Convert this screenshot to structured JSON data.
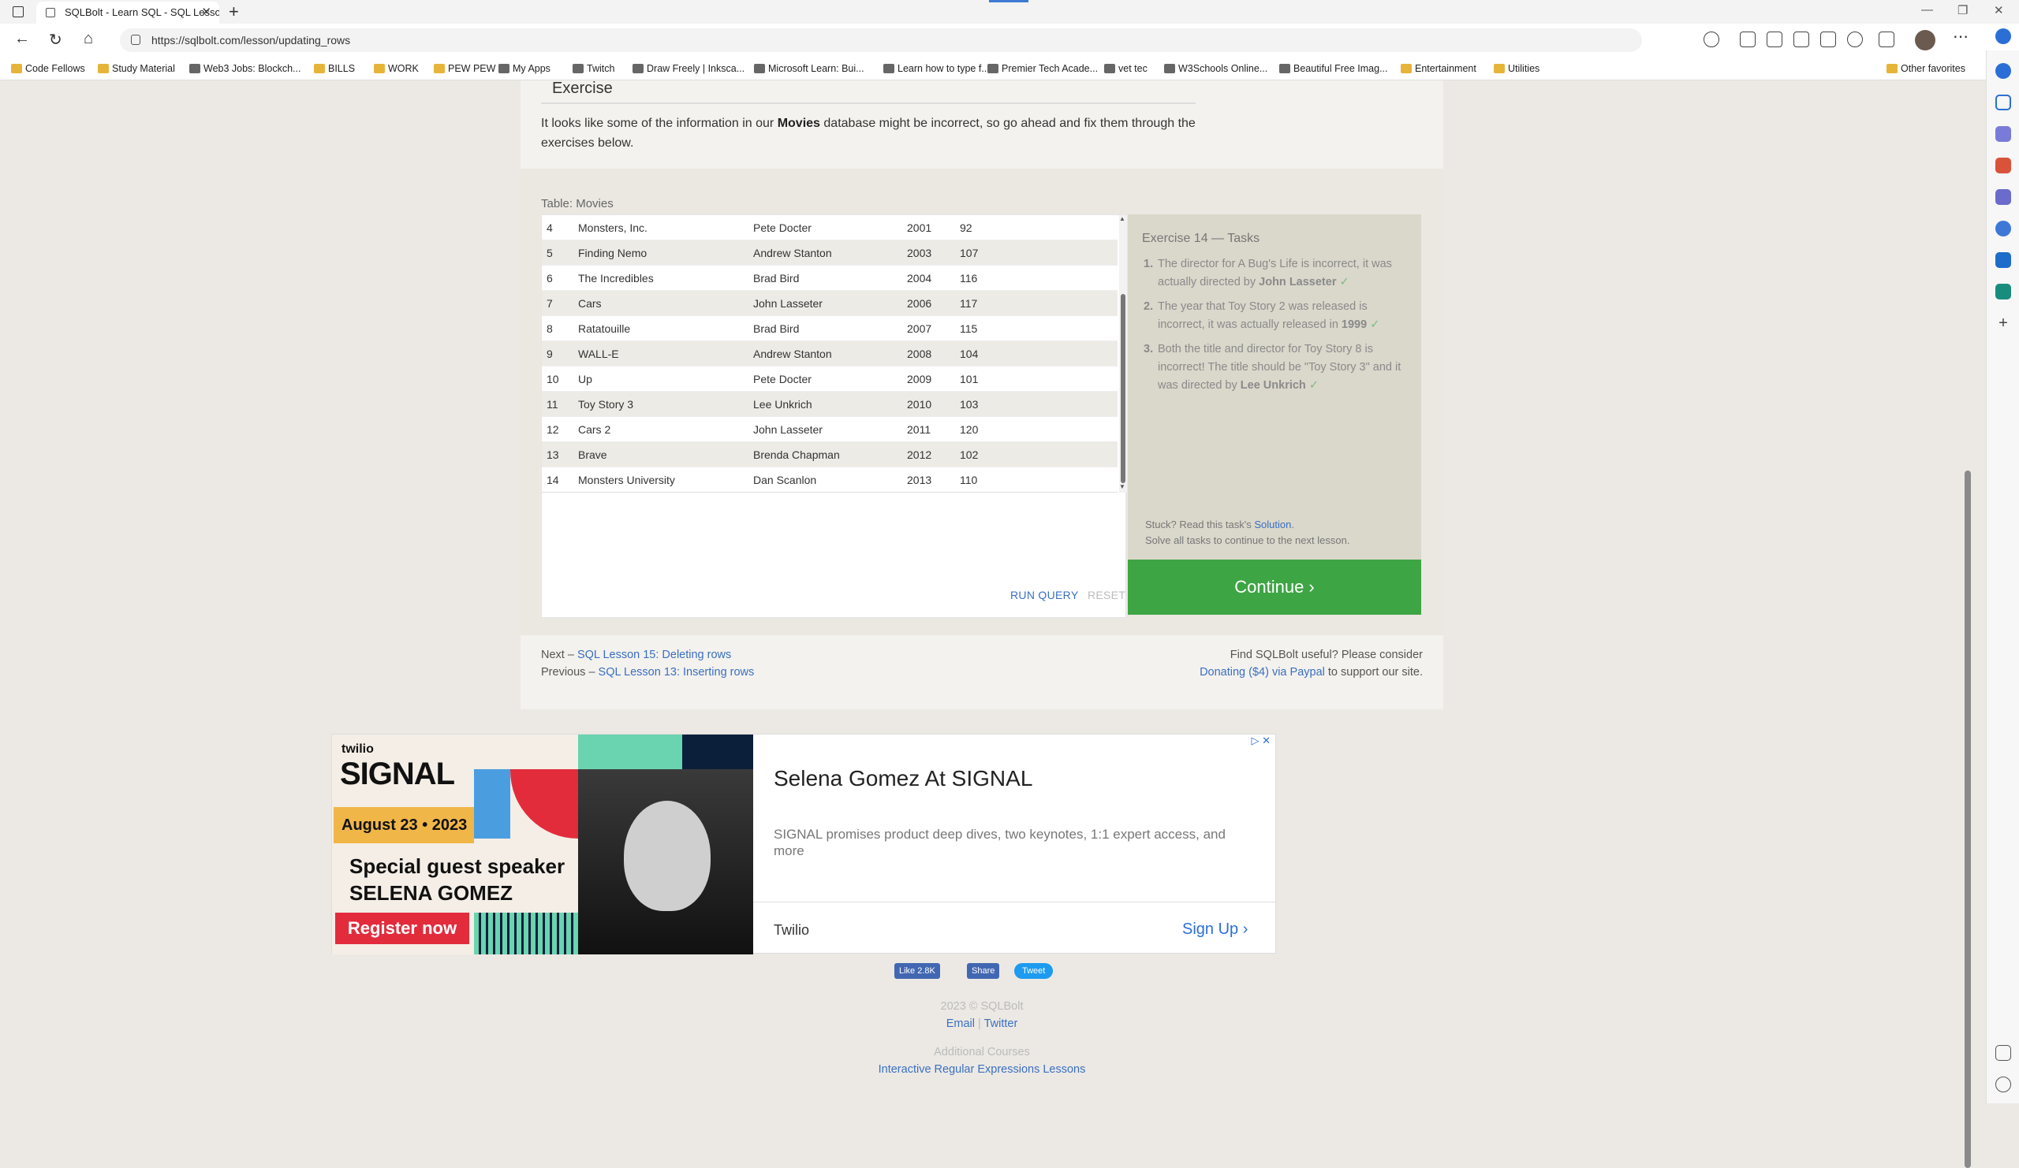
{
  "browser": {
    "tab_title": "SQLBolt - Learn SQL - SQL Lesso",
    "url": "https://sqlbolt.com/lesson/updating_rows",
    "bookmarks": [
      {
        "label": "Code Fellows",
        "type": "folder"
      },
      {
        "label": "Study Material",
        "type": "folder"
      },
      {
        "label": "Web3 Jobs: Blockch...",
        "type": "site"
      },
      {
        "label": "BILLS",
        "type": "folder"
      },
      {
        "label": "WORK",
        "type": "folder"
      },
      {
        "label": "PEW PEW",
        "type": "folder"
      },
      {
        "label": "My Apps",
        "type": "site"
      },
      {
        "label": "Twitch",
        "type": "site"
      },
      {
        "label": "Draw Freely | Inksca...",
        "type": "site"
      },
      {
        "label": "Microsoft Learn: Bui...",
        "type": "site"
      },
      {
        "label": "Learn how to type f...",
        "type": "site"
      },
      {
        "label": "Premier Tech Acade...",
        "type": "site"
      },
      {
        "label": "vet tec",
        "type": "site"
      },
      {
        "label": "W3Schools Online...",
        "type": "site"
      },
      {
        "label": "Beautiful Free Imag...",
        "type": "site"
      },
      {
        "label": "Entertainment",
        "type": "folder"
      },
      {
        "label": "Utilities",
        "type": "folder"
      }
    ],
    "other_favorites": "Other favorites"
  },
  "lesson": {
    "exercise_heading": "Exercise",
    "intro_pre": "It looks like some of the information in our ",
    "intro_bold": "Movies",
    "intro_post": " database might be incorrect, so go ahead and fix them through the exercises below.",
    "table_label": "Table: Movies",
    "rows": [
      [
        "4",
        "Monsters, Inc.",
        "Pete Docter",
        "2001",
        "92"
      ],
      [
        "5",
        "Finding Nemo",
        "Andrew Stanton",
        "2003",
        "107"
      ],
      [
        "6",
        "The Incredibles",
        "Brad Bird",
        "2004",
        "116"
      ],
      [
        "7",
        "Cars",
        "John Lasseter",
        "2006",
        "117"
      ],
      [
        "8",
        "Ratatouille",
        "Brad Bird",
        "2007",
        "115"
      ],
      [
        "9",
        "WALL-E",
        "Andrew Stanton",
        "2008",
        "104"
      ],
      [
        "10",
        "Up",
        "Pete Docter",
        "2009",
        "101"
      ],
      [
        "11",
        "Toy Story 3",
        "Lee Unkrich",
        "2010",
        "103"
      ],
      [
        "12",
        "Cars 2",
        "John Lasseter",
        "2011",
        "120"
      ],
      [
        "13",
        "Brave",
        "Brenda Chapman",
        "2012",
        "102"
      ],
      [
        "14",
        "Monsters University",
        "Dan Scanlon",
        "2013",
        "110"
      ]
    ],
    "run_query": "RUN QUERY",
    "reset": "RESET",
    "tasks_title": "Exercise 14 — Tasks",
    "tasks": [
      {
        "num": "1.",
        "text": "The director for A Bug's Life is incorrect, it was actually directed by ",
        "bold": "John Lasseter",
        "check": "✓"
      },
      {
        "num": "2.",
        "text": "The year that Toy Story 2 was released is incorrect, it was actually released in ",
        "bold": "1999",
        "check": "✓"
      },
      {
        "num": "3.",
        "text": "Both the title and director for Toy Story 8 is incorrect! The title should be \"Toy Story 3\" and it was directed by ",
        "bold": "Lee Unkrich",
        "check": "✓"
      }
    ],
    "stuck_pre": "Stuck? Read this task's ",
    "stuck_link": "Solution",
    "stuck_post": ".",
    "solve_note": "Solve all tasks to continue to the next lesson.",
    "continue": "Continue ›",
    "next_prefix": "Next – ",
    "next_link": "SQL Lesson 15: Deleting rows",
    "prev_prefix": "Previous – ",
    "prev_link": "SQL Lesson 13: Inserting rows",
    "donate_line1": "Find SQLBolt useful? Please consider",
    "donate_link": "Donating ($4) via Paypal",
    "donate_post": " to support our site."
  },
  "ad": {
    "brand": "twilio",
    "event": "SIGNAL",
    "date": "August 23 • 2023",
    "guest_line1": "Special guest speaker",
    "guest_line2": "SELENA GOMEZ",
    "register": "Register now",
    "headline": "Selena Gomez At SIGNAL",
    "description": "SIGNAL promises product deep dives, two keynotes, 1:1 expert access, and more",
    "company": "Twilio",
    "signup": "Sign Up"
  },
  "social": {
    "like": "Like 2.8K",
    "share": "Share",
    "tweet": "Tweet"
  },
  "footer": {
    "copyright": "2023 © SQLBolt",
    "email": "Email",
    "separator": "|",
    "twitter": "Twitter",
    "additional": "Additional Courses",
    "regex_link": "Interactive Regular Expressions Lessons"
  },
  "colors": {
    "continue": "#3ea544",
    "link": "#3a6fc0",
    "ad_red": "#e22c3c",
    "ad_yellow": "#f0b648"
  }
}
